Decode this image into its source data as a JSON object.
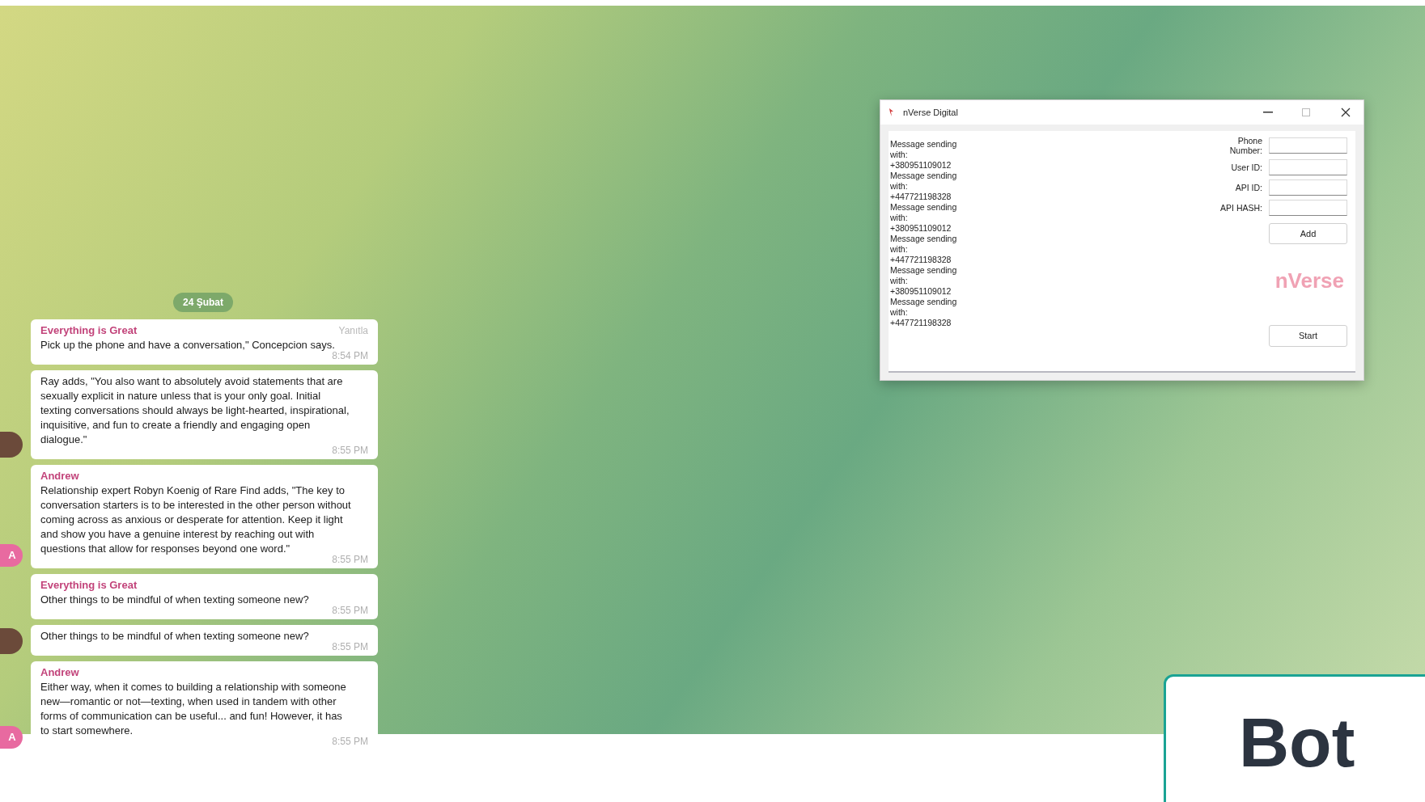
{
  "chat": {
    "date": "24 Şubat",
    "messages": [
      {
        "sender": "Everything is Great",
        "reply_label": "Yanıtla",
        "text": "Pick up the phone and have a conversation,\" Concepcion says.",
        "time": "8:54 PM"
      },
      {
        "text": "Ray adds, \"You also want to absolutely avoid statements that are sexually explicit in nature unless that is your only goal. Initial texting conversations should always be light-hearted, inspirational, inquisitive, and fun to create a friendly and engaging open dialogue.\"",
        "time": "8:55 PM",
        "avatar": {
          "kind": "photo"
        }
      },
      {
        "sender": "Andrew",
        "text": "Relationship expert Robyn Koenig of Rare Find adds, \"The key to conversation starters is to be interested in the other person without coming across as anxious or desperate for attention. Keep it light and show you have a genuine interest by reaching out with questions that allow for responses beyond one word.\"",
        "time": "8:55 PM",
        "avatar": {
          "kind": "letter",
          "letter": "A"
        }
      },
      {
        "sender": "Everything is Great",
        "text": "Other things to be mindful of when texting someone new?",
        "time": "8:55 PM"
      },
      {
        "text": "Other things to be mindful of when texting someone new?",
        "time": "8:55 PM",
        "avatar": {
          "kind": "photo"
        }
      },
      {
        "sender": "Andrew",
        "text": "Either way, when it comes to building a relationship with someone new—romantic or not—texting, when used in tandem with other forms of communication can be useful... and fun! However, it has to start somewhere.",
        "time": "8:55 PM",
        "avatar": {
          "kind": "letter",
          "letter": "A"
        }
      }
    ]
  },
  "window": {
    "title": "nVerse Digital",
    "log": [
      "Message sending with: +380951109012",
      "Message sending with: +447721198328",
      "Message sending with: +380951109012",
      "Message sending with: +447721198328",
      "Message sending with: +380951109012",
      "Message sending with: +447721198328"
    ],
    "fields": [
      {
        "label": "Phone Number:"
      },
      {
        "label": "User ID:"
      },
      {
        "label": "API ID:"
      },
      {
        "label": "API HASH:"
      }
    ],
    "add_button": "Add",
    "logo": "nVerse",
    "start_button": "Start"
  },
  "overlay_card": {
    "text": "Bot"
  }
}
